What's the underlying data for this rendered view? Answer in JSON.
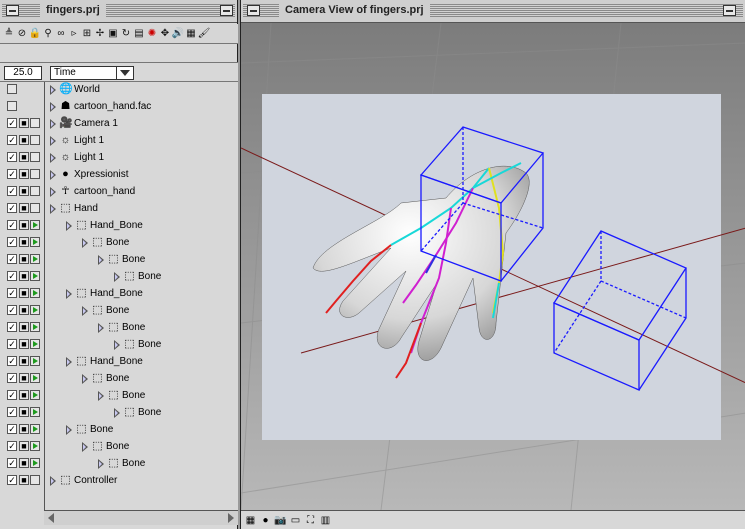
{
  "project_window": {
    "title": "fingers.prj",
    "toolbar_icons": [
      {
        "name": "hierarchy-icon",
        "glyph": "≜"
      },
      {
        "name": "no-symbol-icon",
        "glyph": "⊘"
      },
      {
        "name": "lock-icon",
        "glyph": "🔒"
      },
      {
        "name": "magnifier-icon",
        "glyph": "⚲"
      },
      {
        "name": "link-icon",
        "glyph": "∞"
      },
      {
        "name": "play-arrow-icon",
        "glyph": "▹"
      },
      {
        "name": "grid-icon",
        "glyph": "⊞"
      },
      {
        "name": "bone-icon",
        "glyph": "✢"
      },
      {
        "name": "terminal-icon",
        "glyph": "▣"
      },
      {
        "name": "rotate-icon",
        "glyph": "↻"
      },
      {
        "name": "filmstrip-icon",
        "glyph": "▤"
      },
      {
        "name": "color-wheel-icon",
        "glyph": "✺"
      },
      {
        "name": "move-arrows-icon",
        "glyph": "✥"
      },
      {
        "name": "sound-icon",
        "glyph": "🔊"
      },
      {
        "name": "grid-icon-2",
        "glyph": "▦"
      },
      {
        "name": "paint-icon",
        "glyph": "🖌"
      }
    ],
    "frame_rate": "25.0",
    "property_selector": "Time",
    "tree_rows": [
      {
        "label": "World",
        "icon": "🌐",
        "indent": 0,
        "cols": [
          "box",
          "",
          ""
        ]
      },
      {
        "label": "cartoon_hand.fac",
        "icon": "☗",
        "indent": 0,
        "cols": [
          "box",
          "",
          ""
        ]
      },
      {
        "label": "Camera 1",
        "icon": "🎥",
        "indent": 0,
        "cols": [
          "check",
          "lock",
          "blank"
        ]
      },
      {
        "label": "Light 1",
        "icon": "☼",
        "indent": 0,
        "cols": [
          "check",
          "lock",
          "blank"
        ]
      },
      {
        "label": "Light 1",
        "icon": "☼",
        "indent": 0,
        "cols": [
          "check",
          "lock",
          "blank"
        ]
      },
      {
        "label": "Xpressionist",
        "icon": "●",
        "indent": 0,
        "cols": [
          "check",
          "lock",
          "blank"
        ]
      },
      {
        "label": "cartoon_hand",
        "icon": "☥",
        "indent": 0,
        "cols": [
          "check",
          "lock",
          "blank"
        ]
      },
      {
        "label": "Hand",
        "icon": "⬚",
        "indent": 0,
        "cols": [
          "check",
          "lock",
          "blank"
        ]
      },
      {
        "label": "Hand_Bone",
        "icon": "⬚",
        "indent": 1,
        "cols": [
          "check",
          "lock",
          "play"
        ]
      },
      {
        "label": "Bone",
        "icon": "⬚",
        "indent": 2,
        "cols": [
          "check",
          "lock",
          "play"
        ]
      },
      {
        "label": "Bone",
        "icon": "⬚",
        "indent": 3,
        "cols": [
          "check",
          "lock",
          "play"
        ]
      },
      {
        "label": "Bone",
        "icon": "⬚",
        "indent": 4,
        "cols": [
          "check",
          "lock",
          "play"
        ]
      },
      {
        "label": "Hand_Bone",
        "icon": "⬚",
        "indent": 1,
        "cols": [
          "check",
          "lock",
          "play"
        ]
      },
      {
        "label": "Bone",
        "icon": "⬚",
        "indent": 2,
        "cols": [
          "check",
          "lock",
          "play"
        ]
      },
      {
        "label": "Bone",
        "icon": "⬚",
        "indent": 3,
        "cols": [
          "check",
          "lock",
          "play"
        ]
      },
      {
        "label": "Bone",
        "icon": "⬚",
        "indent": 4,
        "cols": [
          "check",
          "lock",
          "play"
        ]
      },
      {
        "label": "Hand_Bone",
        "icon": "⬚",
        "indent": 1,
        "cols": [
          "check",
          "lock",
          "play"
        ]
      },
      {
        "label": "Bone",
        "icon": "⬚",
        "indent": 2,
        "cols": [
          "check",
          "lock",
          "play"
        ]
      },
      {
        "label": "Bone",
        "icon": "⬚",
        "indent": 3,
        "cols": [
          "check",
          "lock",
          "play"
        ]
      },
      {
        "label": "Bone",
        "icon": "⬚",
        "indent": 4,
        "cols": [
          "check",
          "lock",
          "play"
        ]
      },
      {
        "label": "Bone",
        "icon": "⬚",
        "indent": 1,
        "cols": [
          "check",
          "lock",
          "play"
        ]
      },
      {
        "label": "Bone",
        "icon": "⬚",
        "indent": 2,
        "cols": [
          "check",
          "lock",
          "play"
        ]
      },
      {
        "label": "Bone",
        "icon": "⬚",
        "indent": 3,
        "cols": [
          "check",
          "lock",
          "play"
        ]
      },
      {
        "label": "Controller",
        "icon": "⬚",
        "indent": 0,
        "cols": [
          "check",
          "lock",
          "blank"
        ]
      }
    ]
  },
  "camera_window": {
    "title": "Camera View of fingers.prj",
    "status_icons": [
      {
        "name": "grid-view-icon",
        "glyph": "▦"
      },
      {
        "name": "sphere-icon",
        "glyph": "●"
      },
      {
        "name": "camera-icon",
        "glyph": "📷"
      },
      {
        "name": "frame-icon",
        "glyph": "▭"
      },
      {
        "name": "fit-icon",
        "glyph": "⛶"
      },
      {
        "name": "color-bars-icon",
        "glyph": "▥"
      }
    ]
  },
  "colors": {
    "selection_box": "#1a1aff",
    "bone_cyan": "#18d8d8",
    "bone_red": "#e02020",
    "bone_magenta": "#d020d0",
    "bone_blue": "#3030e0",
    "bone_yellow": "#e0e020"
  }
}
